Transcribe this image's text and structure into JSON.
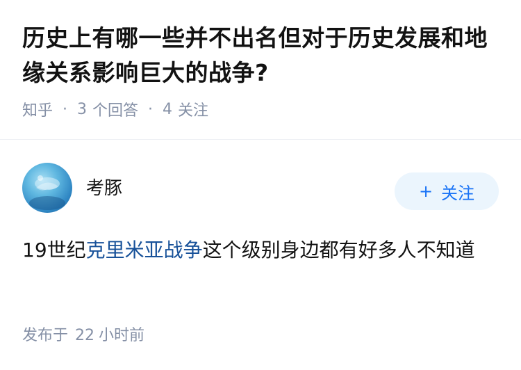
{
  "question": {
    "title": "历史上有哪一些并不出名但对于历史发展和地缘关系影响巨大的战争?",
    "meta": {
      "source": "知乎",
      "answer_count": "3",
      "answer_label": "个回答",
      "follow_count": "4",
      "follow_label": "关注"
    }
  },
  "answer": {
    "author": {
      "name": "考豚",
      "avatar_icon": "avatar-image"
    },
    "follow_button": {
      "icon": "plus-icon",
      "icon_glyph": "+",
      "label": "关注"
    },
    "content": {
      "prefix": "19世纪",
      "link_text": "克里米亚战争",
      "suffix": "这个级别身边都有好多人不知道"
    },
    "posted": {
      "label": "发布于",
      "value": "22",
      "unit": "小时前"
    }
  },
  "colors": {
    "accent": "#1772f6",
    "link": "#175199",
    "muted": "#8590a6",
    "button_bg": "#ebf5fd"
  }
}
